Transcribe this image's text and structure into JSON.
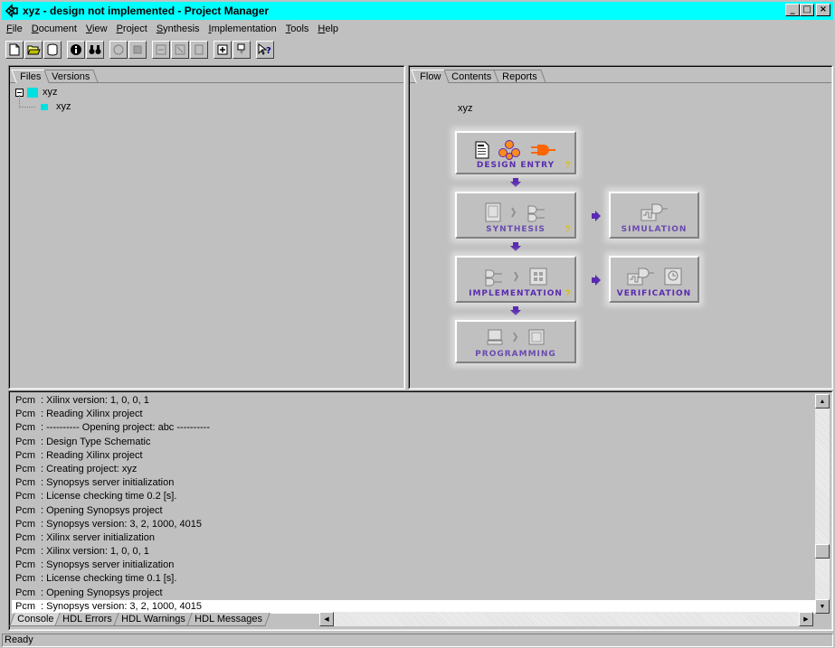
{
  "window": {
    "title": "xyz - design not implemented - Project Manager",
    "min_label": "_",
    "max_label": "□",
    "close_label": "×"
  },
  "menu": {
    "items": [
      {
        "label": "File",
        "ul": "F",
        "rest": "ile"
      },
      {
        "label": "Document",
        "ul": "D",
        "rest": "ocument"
      },
      {
        "label": "View",
        "ul": "V",
        "rest": "iew"
      },
      {
        "label": "Project",
        "ul": "P",
        "rest": "roject"
      },
      {
        "label": "Synthesis",
        "ul": "S",
        "rest": "ynthesis"
      },
      {
        "label": "Implementation",
        "ul": "I",
        "rest": "mplementation"
      },
      {
        "label": "Tools",
        "ul": "T",
        "rest": "ools"
      },
      {
        "label": "Help",
        "ul": "H",
        "rest": "elp"
      }
    ]
  },
  "toolbar": {
    "icons": [
      "new-document-icon",
      "open-folder-icon",
      "database-icon",
      "info-icon",
      "binoculars-icon",
      "disabled-icon-1",
      "disabled-icon-2",
      "disabled-icon-3",
      "disabled-icon-4",
      "disabled-icon-5",
      "add-source-icon",
      "import-icon",
      "context-help-icon"
    ]
  },
  "left_pane": {
    "tabs": [
      "Files",
      "Versions"
    ],
    "tree": {
      "root": "xyz",
      "child": "xyz"
    }
  },
  "right_pane": {
    "tabs": [
      "Flow",
      "Contents",
      "Reports"
    ],
    "project_name": "xyz",
    "flow": {
      "design_entry": "Design Entry",
      "synthesis": "Synthesis",
      "simulation": "Simulation",
      "implementation": "Implementation",
      "verification": "Verification",
      "programming": "Programming",
      "help_mark": "?"
    }
  },
  "console": {
    "lines": [
      {
        "src": "Pcm",
        "msg": ": Xilinx version: 1, 0, 0, 1"
      },
      {
        "src": "Pcm",
        "msg": ": Reading Xilinx project"
      },
      {
        "src": "Pcm",
        "msg": ": ---------- Opening project: abc ----------"
      },
      {
        "src": "Pcm",
        "msg": ": Design Type Schematic"
      },
      {
        "src": "Pcm",
        "msg": ": Reading Xilinx project"
      },
      {
        "src": "Pcm",
        "msg": ": Creating project: xyz"
      },
      {
        "src": "Pcm",
        "msg": ": Synopsys server initialization"
      },
      {
        "src": "Pcm",
        "msg": ": License checking time 0.2 [s]."
      },
      {
        "src": "Pcm",
        "msg": ": Opening Synopsys project"
      },
      {
        "src": "Pcm",
        "msg": ": Synopsys version: 3, 2, 1000, 4015"
      },
      {
        "src": "Pcm",
        "msg": ": Xilinx server initialization"
      },
      {
        "src": "Pcm",
        "msg": ": Xilinx version: 1, 0, 0, 1"
      },
      {
        "src": "Pcm",
        "msg": ": Synopsys server initialization"
      },
      {
        "src": "Pcm",
        "msg": ": License checking time 0.1 [s]."
      },
      {
        "src": "Pcm",
        "msg": ": Opening Synopsys project"
      },
      {
        "src": "Pcm",
        "msg": ": Synopsys version: 3, 2, 1000, 4015"
      }
    ],
    "selected_index": 15,
    "tabs": [
      "Console",
      "HDL Errors",
      "HDL Warnings",
      "HDL Messages"
    ]
  },
  "status": {
    "text": "Ready"
  },
  "colors": {
    "titlebar": "#00ffff",
    "flow_accent": "#5a2bb0",
    "help_mark": "#e0c000"
  }
}
